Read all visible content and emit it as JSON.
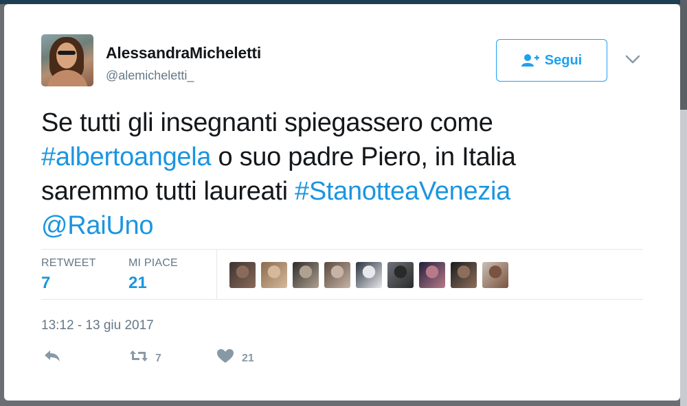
{
  "tweet": {
    "display_name": "AlessandraMicheletti",
    "handle": "@alemicheletti_",
    "follow_label": "Segui",
    "text_parts": [
      {
        "text": "Se tutti gli insegnanti spiegassero come ",
        "type": "plain"
      },
      {
        "text": "#albertoangela",
        "type": "link"
      },
      {
        "text": " o suo padre Piero, in Italia saremmo tutti laureati ",
        "type": "plain"
      },
      {
        "text": "#StanotteaVenezia",
        "type": "link"
      },
      {
        "text": " ",
        "type": "plain"
      },
      {
        "text": "@RaiUno",
        "type": "link"
      }
    ],
    "timestamp": "13:12 - 13 giu 2017"
  },
  "stats": {
    "retweet_label": "RETWEET",
    "retweet_count": "7",
    "like_label": "MI PIACE",
    "like_count": "21"
  },
  "actions": {
    "retweet_count": "7",
    "like_count": "21"
  },
  "likers": [
    {
      "c1": "#3b3330",
      "c2": "#8a6a5a"
    },
    {
      "c1": "#8a6b4f",
      "c2": "#d6b89a"
    },
    {
      "c1": "#2d2d2d",
      "c2": "#b0a090"
    },
    {
      "c1": "#5a4a40",
      "c2": "#c7b3a5"
    },
    {
      "c1": "#2b3440",
      "c2": "#e8e8ec"
    },
    {
      "c1": "#6d7177",
      "c2": "#2a2a2a"
    },
    {
      "c1": "#20203a",
      "c2": "#b87a8a"
    },
    {
      "c1": "#1c1c1c",
      "c2": "#8c6e5c"
    },
    {
      "c1": "#c9c0b5",
      "c2": "#7a5340"
    }
  ],
  "colors": {
    "accent": "#1da1f2",
    "link": "#1b95e0",
    "text": "#14171a",
    "muted": "#657786"
  }
}
